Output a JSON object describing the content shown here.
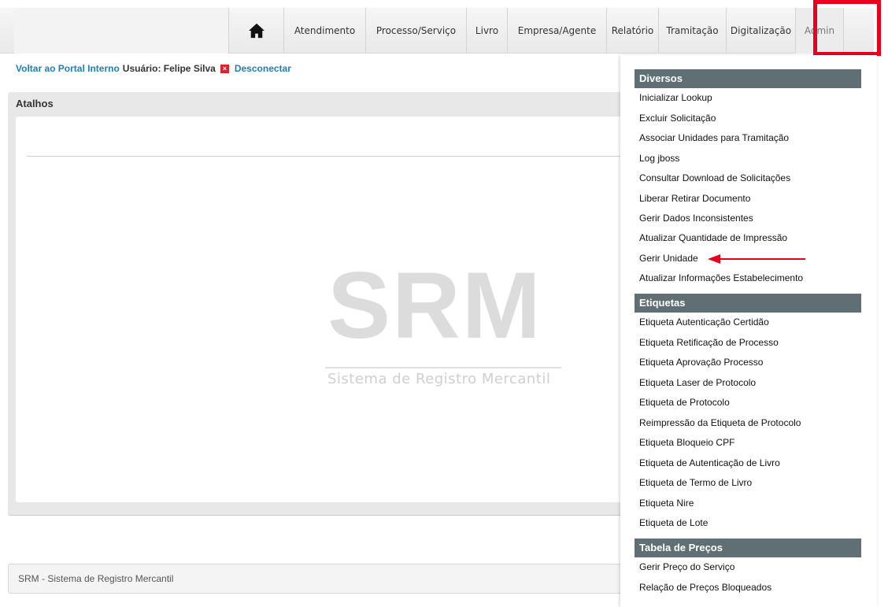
{
  "nav": {
    "home_icon": "home-icon",
    "items": [
      "Atendimento",
      "Processo/Serviço",
      "Livro",
      "Empresa/Agente",
      "Relatório",
      "Tramitação",
      "Digitalização",
      "Admin"
    ]
  },
  "session": {
    "portal_link": "Voltar ao Portal Interno",
    "user_label": "Usuário: Felipe Silva",
    "disconnect": "Desconectar"
  },
  "panel": {
    "title": "Atalhos",
    "logo_text": "SRM",
    "logo_subtitle": "Sistema de Registro Mercantil"
  },
  "footer": {
    "text": "SRM - Sistema de Registro Mercantil"
  },
  "dropdown": {
    "sections": [
      {
        "title": "Diversos",
        "items": [
          "Inicializar Lookup",
          "Excluir Solicitação",
          "Associar Unidades para Tramitação",
          "Log jboss",
          "Consultar Download de Solicitações",
          "Liberar Retirar Documento",
          "Gerir Dados Inconsistentes",
          "Atualizar Quantidade de Impressão",
          "Gerir Unidade",
          "Atualizar Informações Estabelecimento"
        ]
      },
      {
        "title": "Etiquetas",
        "items": [
          "Etiqueta Autenticação Certidão",
          "Etiqueta Retificação de Processo",
          "Etiqueta Aprovação Processo",
          "Etiqueta Laser de Protocolo",
          "Etiqueta de Protocolo",
          "Reimpressão da Etiqueta de Protocolo",
          "Etiqueta Bloqueio CPF",
          "Etiqueta de Autenticação de Livro",
          "Etiqueta de Termo de Livro",
          "Etiqueta Nire",
          "Etiqueta de Lote"
        ]
      },
      {
        "title": "Tabela de Preços",
        "items": [
          "Gerir Preço do Serviço",
          "Relação de Preços Bloqueados"
        ]
      }
    ]
  },
  "colors": {
    "highlight": "#e8001c",
    "link": "#1a7fc0",
    "section_header": "#5f6f74"
  }
}
